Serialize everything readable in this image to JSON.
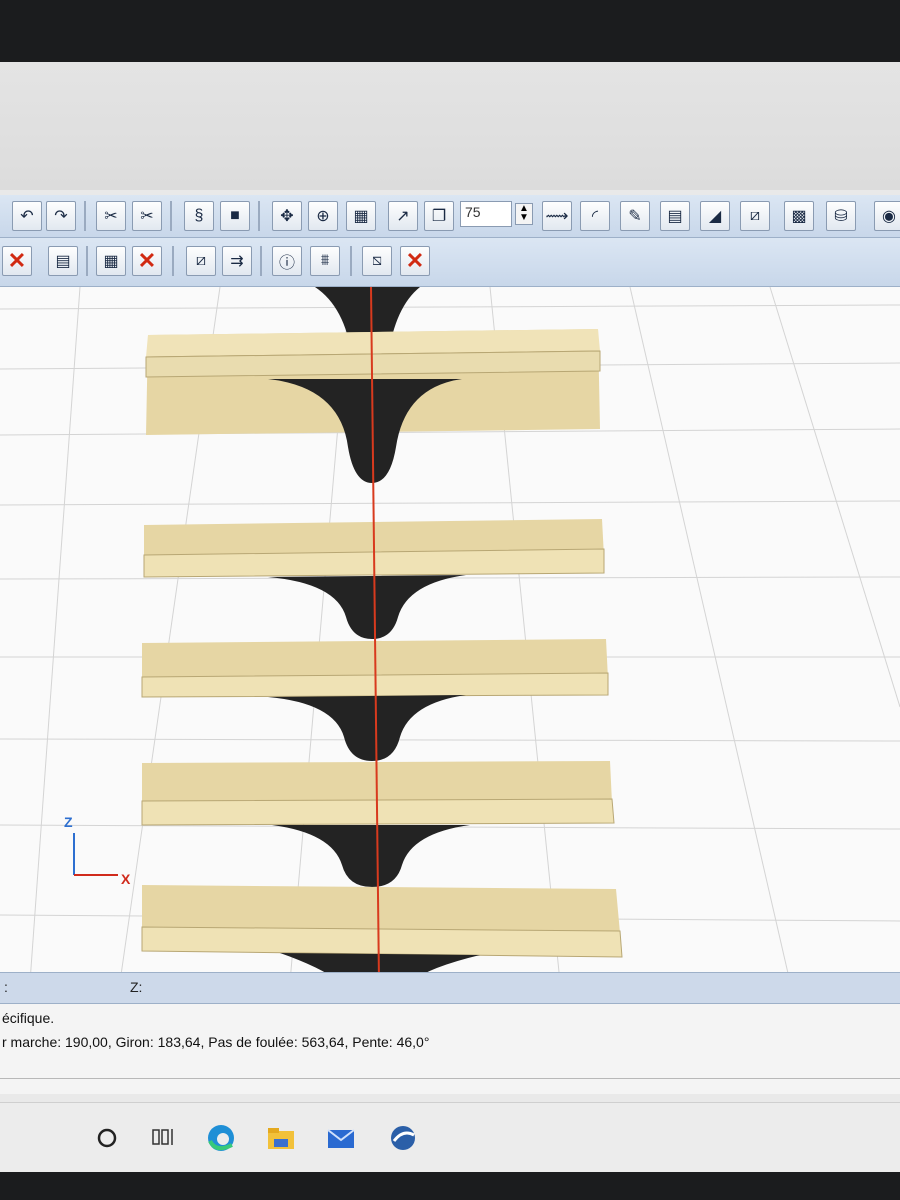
{
  "toolbar": {
    "zoom_value": "75",
    "row1_icons": [
      "undo-icon",
      "redo-icon",
      "cut-a-icon",
      "cut-b-icon",
      "spring-icon",
      "block-icon",
      "move-icon",
      "target-icon",
      "grid-icon",
      "axes-icon",
      "cube-icon",
      "pipe-icon",
      "arc-icon",
      "pencil-icon",
      "wall-icon",
      "slope-icon",
      "stair-icon",
      "texture-icon",
      "bucket-icon",
      "palette-icon"
    ],
    "row2_icons": [
      "close-icon",
      "add-wall-icon",
      "wall-grid-icon",
      "close-icon",
      "add-stair-icon",
      "stair-arrow-icon",
      "stair-info-icon",
      "railing-icon",
      "stair-remove-icon",
      "close-icon"
    ]
  },
  "canvas": {
    "axis_z_label": "Z",
    "axis_x_label": "X",
    "tread_color": "#e6d6a4",
    "stringer_color": "#232323",
    "centerline_color": "#d83a1e"
  },
  "coord_bar": {
    "left_label": ":",
    "z_label": "Z:"
  },
  "status": {
    "line1": "écifique.",
    "line2": "r marche: 190,00, Giron: 183,64, Pas de foulée: 563,64, Pente: 46,0°"
  },
  "taskbar": {
    "icons": [
      "search-circle-icon",
      "task-view-icon",
      "edge-icon",
      "file-explorer-icon",
      "mail-icon",
      "app-icon"
    ]
  }
}
